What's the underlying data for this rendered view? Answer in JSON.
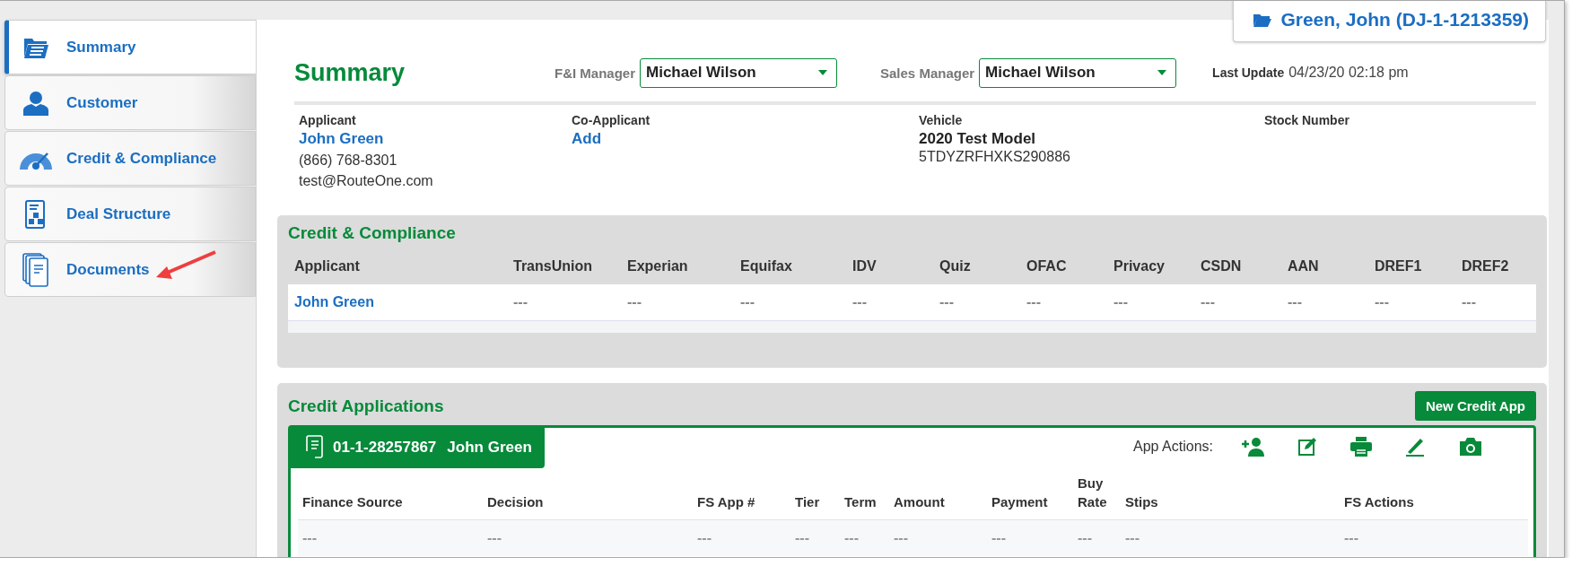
{
  "case_tab": {
    "label": "Green, John (DJ-1-1213359)"
  },
  "sidebar": {
    "items": [
      {
        "label": "Summary",
        "kind": "summary",
        "selected": true
      },
      {
        "label": "Customer",
        "kind": "customer",
        "selected": false
      },
      {
        "label": "Credit & Compliance",
        "kind": "gauge",
        "selected": false
      },
      {
        "label": "Deal Structure",
        "kind": "deal",
        "selected": false
      },
      {
        "label": "Documents",
        "kind": "documents",
        "selected": false
      }
    ]
  },
  "summary": {
    "title": "Summary",
    "managers": [
      {
        "label": "F&I Manager",
        "value": "Michael Wilson"
      },
      {
        "label": "Sales Manager",
        "value": "Michael Wilson"
      }
    ],
    "last_update": {
      "label": "Last Update",
      "value": "04/23/20 02:18 pm"
    },
    "parties": [
      {
        "label": "Applicant",
        "lines": [
          {
            "kind": "link",
            "text": "John Green"
          },
          {
            "kind": "plain",
            "text": "(866) 768-8301"
          },
          {
            "kind": "plain",
            "text": "test@RouteOne.com"
          }
        ]
      },
      {
        "label": "Co-Applicant",
        "lines": [
          {
            "kind": "link",
            "text": "Add"
          }
        ]
      },
      {
        "label": "Vehicle",
        "lines": [
          {
            "kind": "bold",
            "text": "2020 Test Model"
          },
          {
            "kind": "plain",
            "text": "5TDYZRFHXKS290886"
          }
        ]
      },
      {
        "label": "Stock Number"
      }
    ]
  },
  "credit_compliance": {
    "title": "Credit & Compliance",
    "columns": [
      "Applicant",
      "TransUnion",
      "Experian",
      "Equifax",
      "IDV",
      "Quiz",
      "OFAC",
      "Privacy",
      "CSDN",
      "AAN",
      "DREF1",
      "DREF2"
    ],
    "rows": [
      {
        "cells": [
          "John Green",
          "---",
          "---",
          "---",
          "---",
          "---",
          "---",
          "---",
          "---",
          "---",
          "---",
          "---"
        ]
      }
    ]
  },
  "credit_applications": {
    "title": "Credit Applications",
    "button": "New Credit App",
    "app": {
      "number": "01-1-28257867",
      "name": "John Green",
      "actions_label": "App Actions:",
      "actions": [
        {
          "kind": "add-person"
        },
        {
          "kind": "edit"
        },
        {
          "kind": "print"
        },
        {
          "kind": "sign"
        },
        {
          "kind": "camera"
        }
      ]
    },
    "columns": [
      "Finance Source",
      "Decision",
      "FS App #",
      "Tier",
      "Term",
      "Amount",
      "Payment",
      "Buy Rate",
      "Stips",
      "FS Actions"
    ],
    "rows": [
      {
        "cells": [
          "---",
          "---",
          "---",
          "---",
          "---",
          "---",
          "---",
          "---",
          "---",
          "---"
        ]
      }
    ]
  }
}
